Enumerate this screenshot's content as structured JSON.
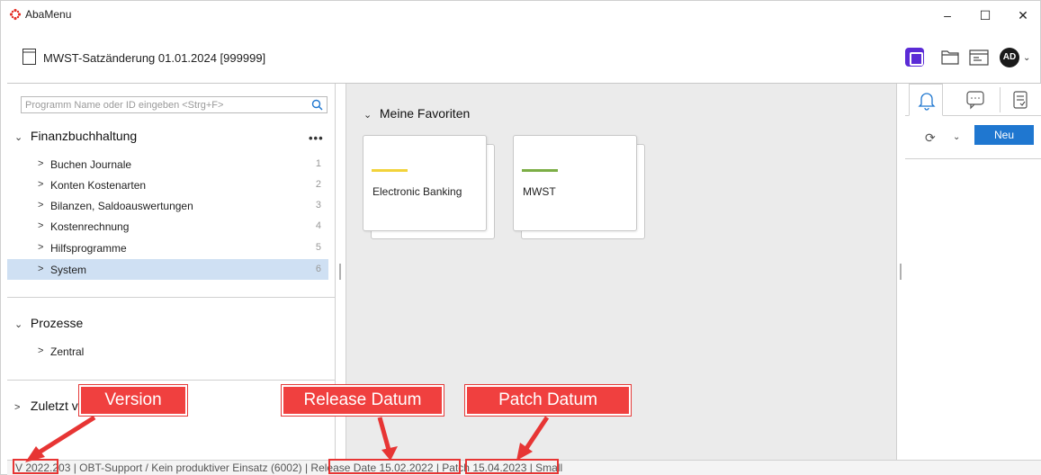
{
  "window": {
    "app_title": "AbaMenu",
    "minimize": "–",
    "maximize": "☐",
    "close": "✕"
  },
  "header": {
    "document_title": "MWST-Satzänderung 01.01.2024 [999999]",
    "avatar_initials": "AD"
  },
  "search": {
    "placeholder": "Programm Name oder ID eingeben <Strg+F>"
  },
  "sections": {
    "finanz": {
      "label": "Finanzbuchhaltung",
      "items": [
        {
          "label": "Buchen Journale",
          "num": "1"
        },
        {
          "label": "Konten Kostenarten",
          "num": "2"
        },
        {
          "label": "Bilanzen, Saldoauswertungen",
          "num": "3"
        },
        {
          "label": "Kostenrechnung",
          "num": "4"
        },
        {
          "label": "Hilfsprogramme",
          "num": "5"
        },
        {
          "label": "System",
          "num": "6"
        }
      ],
      "selected_index": 5
    },
    "prozesse": {
      "label": "Prozesse",
      "items": [
        {
          "label": "Zentral"
        }
      ]
    },
    "zuletzt": {
      "label": "Zuletzt v"
    }
  },
  "favorites": {
    "header": "Meine Favoriten",
    "tiles": [
      {
        "label": "Electronic Banking",
        "color": "#f2d33b"
      },
      {
        "label": "MWST",
        "color": "#7cae45"
      }
    ]
  },
  "right_panel": {
    "new_button": "Neu"
  },
  "status": {
    "text": "V 2022.203  |  OBT-Support / Kein produktiver Einsatz (6002)  |  Release Date 15.02.2022  |  Patch 15.04.2023  |  Small"
  },
  "annotations": {
    "version": "Version",
    "release": "Release Datum",
    "patch": "Patch Datum",
    "color": "#f0403f"
  },
  "colors": {
    "accent_blue": "#1f77d0",
    "selected_row": "#cfe0f3",
    "purple": "#5b2bd6"
  }
}
